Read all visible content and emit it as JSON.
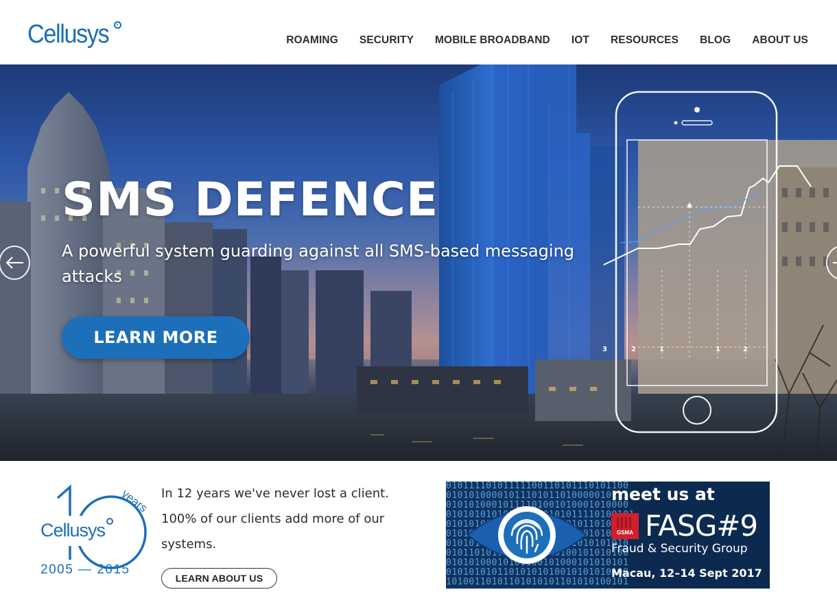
{
  "header": {
    "logo_text": "Cellusys",
    "nav": [
      "ROAMING",
      "SECURITY",
      "MOBILE BROADBAND",
      "IOT",
      "RESOURCES",
      "BLOG",
      "ABOUT US"
    ]
  },
  "hero": {
    "title": "SMS DEFENCE",
    "subtitle": "A powerful system guarding against all SMS-based messaging attacks",
    "button_label": "LEARN MORE",
    "phone_chart_ticks": [
      "3",
      "2",
      "1",
      "1",
      "2"
    ]
  },
  "anniversary_badge": {
    "number": "10",
    "years_label": "years",
    "brand": "Cellusys",
    "range": "2005 — 2015"
  },
  "intro": {
    "text": "In 12 years we've never lost a client. 100% of our clients add more of our systems.",
    "button_label": "LEARN ABOUT US"
  },
  "promo": {
    "meet_label": "meet us at",
    "gsma_label": "GSMA",
    "event_name": "FASG#9",
    "event_subtitle": "Fraud & Security Group",
    "event_date": "Macau, 12–14 Sept 2017"
  },
  "colors": {
    "brand_blue": "#1c6fb7",
    "hero_button": "#1d6fba",
    "gsma_red": "#d11f2c"
  }
}
